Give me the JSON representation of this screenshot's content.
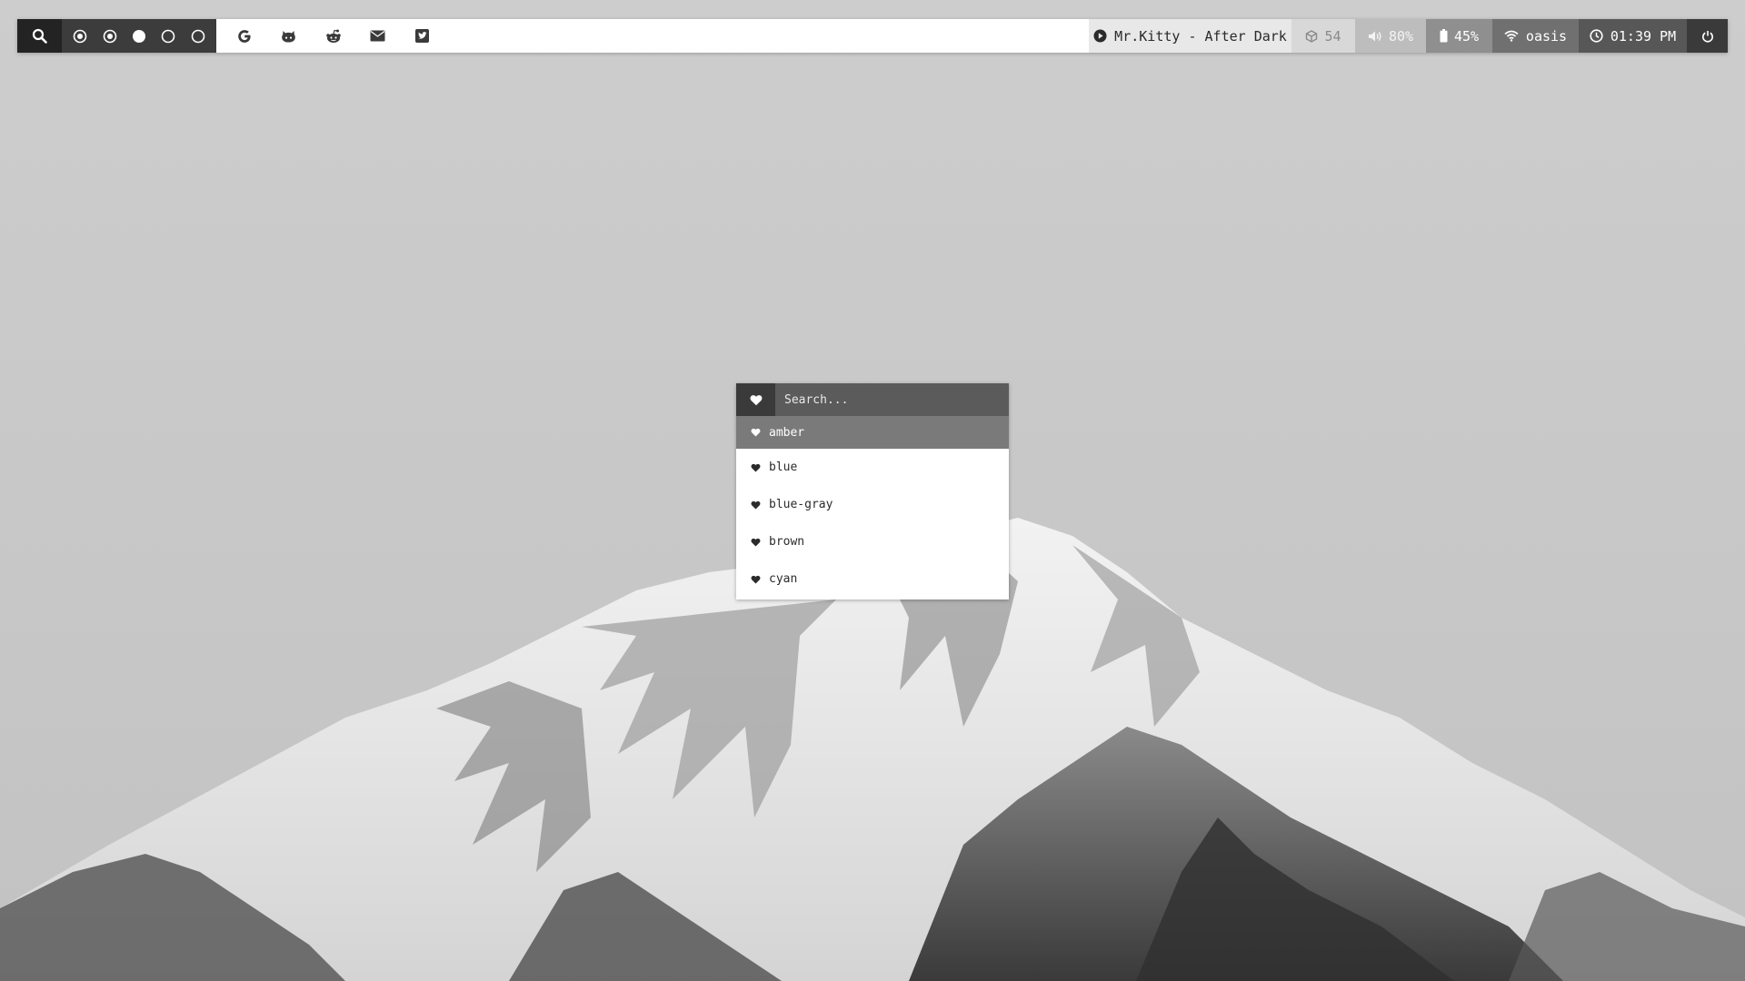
{
  "wallpaper": {
    "subject": "snow-covered mountain peak"
  },
  "topbar": {
    "launcher_icon": "search-icon",
    "workspaces": [
      {
        "state": "occupied"
      },
      {
        "state": "occupied"
      },
      {
        "state": "focused"
      },
      {
        "state": "empty"
      },
      {
        "state": "empty"
      }
    ],
    "shortcuts": [
      {
        "icon": "google-icon"
      },
      {
        "icon": "github-icon"
      },
      {
        "icon": "reddit-icon"
      },
      {
        "icon": "mail-icon"
      },
      {
        "icon": "twitter-icon"
      }
    ],
    "music": {
      "icon": "play-circle-icon",
      "text": "Mr.Kitty - After Dark"
    },
    "updates": {
      "icon": "package-icon",
      "count": "54"
    },
    "volume": {
      "icon": "volume-icon",
      "value": "80%"
    },
    "battery": {
      "icon": "battery-icon",
      "value": "45%"
    },
    "network": {
      "icon": "wifi-icon",
      "ssid": "oasis"
    },
    "clock": {
      "icon": "clock-icon",
      "time": "01:39 PM"
    },
    "power": {
      "icon": "power-icon"
    }
  },
  "launcher_menu": {
    "prompt_icon": "heart-icon",
    "search_placeholder": "Search...",
    "items": [
      {
        "label": "amber",
        "selected": true
      },
      {
        "label": "blue",
        "selected": false
      },
      {
        "label": "blue-gray",
        "selected": false
      },
      {
        "label": "brown",
        "selected": false
      },
      {
        "label": "cyan",
        "selected": false
      }
    ]
  },
  "colors": {
    "bar_bg": "#ffffff",
    "bar_dark": "#232323",
    "menu_header": "#5b5b5b",
    "menu_selected": "#7a7a7a"
  }
}
